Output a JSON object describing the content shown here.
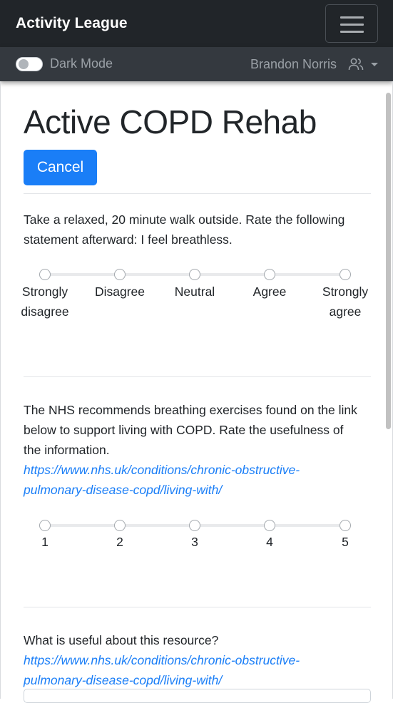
{
  "navbar": {
    "brand": "Activity League",
    "dark_mode_label": "Dark Mode",
    "user_name": "Brandon Norris"
  },
  "page": {
    "title": "Active COPD Rehab",
    "cancel_label": "Cancel"
  },
  "questions": [
    {
      "text": "Take a relaxed, 20 minute walk outside. Rate the following statement afterward: I feel breathless.",
      "options": [
        [
          "Strongly",
          "disagree"
        ],
        [
          "Disagree"
        ],
        [
          "Neutral"
        ],
        [
          "Agree"
        ],
        [
          "Strongly",
          "agree"
        ]
      ]
    },
    {
      "text": "The NHS recommends breathing exercises found on the link below to support living with COPD. Rate the usefulness of the information.",
      "link_line1": "https://www.nhs.uk/conditions/chronic-obstructive-",
      "link_line2": "pulmonary-disease-copd/living-with/",
      "options": [
        [
          "1"
        ],
        [
          "2"
        ],
        [
          "3"
        ],
        [
          "4"
        ],
        [
          "5"
        ]
      ]
    },
    {
      "text": "What is useful about this resource?",
      "link_line1": "https://www.nhs.uk/conditions/chronic-obstructive-",
      "link_line2": "pulmonary-disease-copd/living-with/"
    }
  ],
  "colors": {
    "navbar_bg": "#212529",
    "subbar_bg": "#34393f",
    "primary": "#1a7ef7",
    "link": "#1a7ef7"
  }
}
